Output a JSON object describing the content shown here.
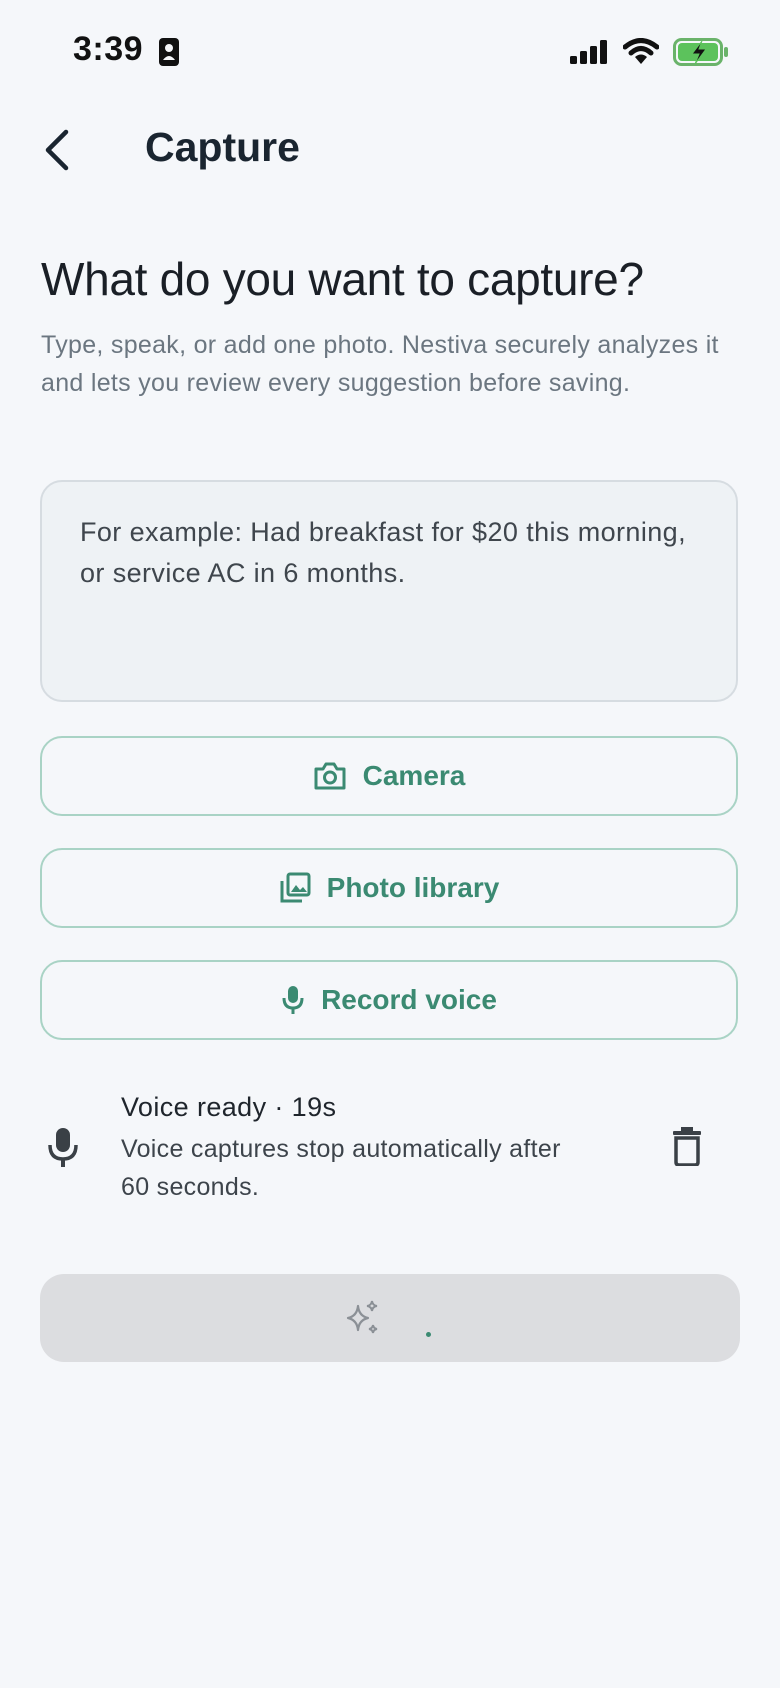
{
  "status_bar": {
    "time": "3:39"
  },
  "header": {
    "title": "Capture"
  },
  "intro": {
    "heading": "What do you want to capture?",
    "subtitle": "Type, speak, or add one photo. Nestiva securely analyzes it and lets you review every suggestion before saving."
  },
  "input": {
    "placeholder": "For example: Had breakfast for $20 this morning, or service AC in 6 months."
  },
  "actions": {
    "camera_label": "Camera",
    "photo_library_label": "Photo library",
    "record_voice_label": "Record voice"
  },
  "voice": {
    "status": "Voice ready · 19s",
    "note": "Voice captures stop automatically after 60 seconds."
  },
  "colors": {
    "accent": "#3b8a72",
    "accent_border": "#a9d3c5",
    "background": "#f5f7fa",
    "disabled_button": "#dcdde0"
  },
  "icons": [
    "back-chevron-icon",
    "camera-icon",
    "photo-library-icon",
    "mic-icon",
    "trash-icon",
    "sparkles-icon",
    "signal-icon",
    "wifi-icon",
    "battery-charging-icon",
    "contact-card-icon"
  ]
}
